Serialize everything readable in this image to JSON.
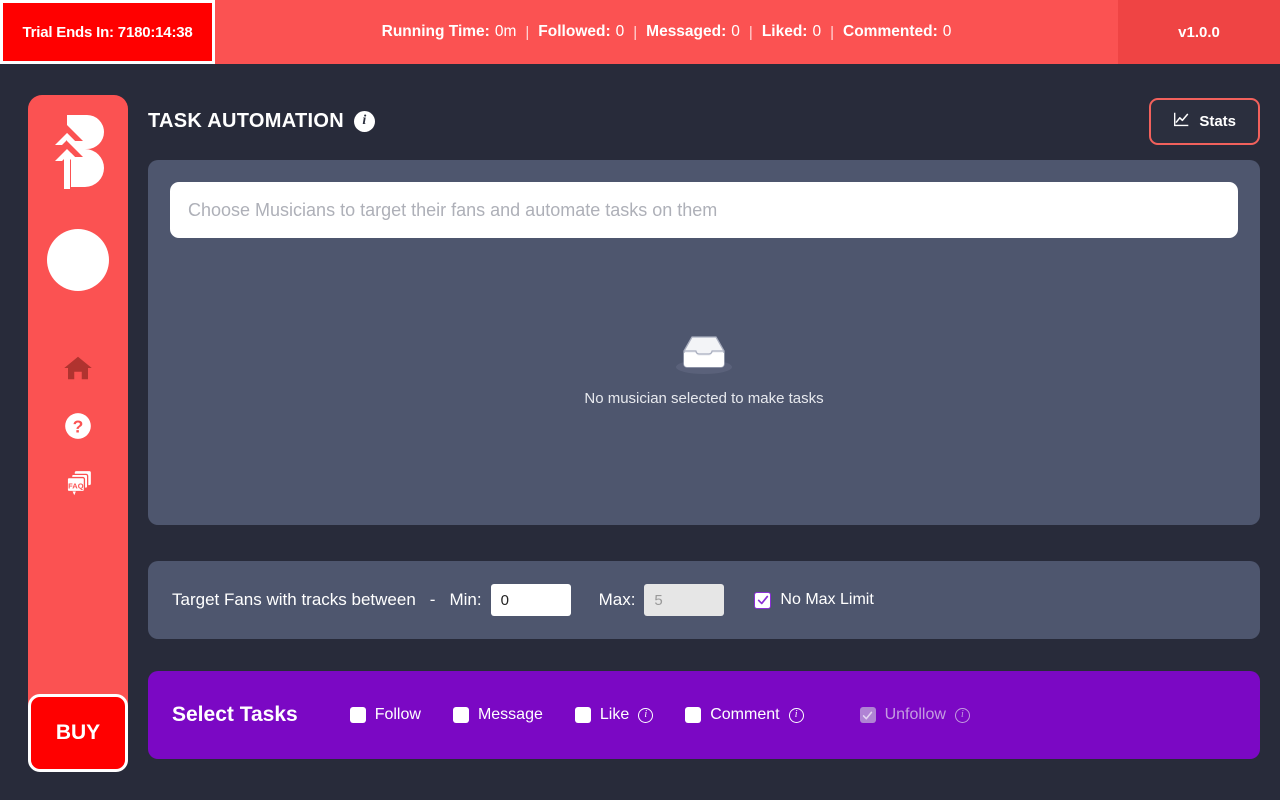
{
  "topbar": {
    "trial_label": "Trial Ends In: 7180:14:38",
    "stats": [
      {
        "label": "Running Time:",
        "value": "0m"
      },
      {
        "label": "Followed:",
        "value": "0"
      },
      {
        "label": "Messaged:",
        "value": "0"
      },
      {
        "label": "Liked:",
        "value": "0"
      },
      {
        "label": "Commented:",
        "value": "0"
      }
    ],
    "separator": "|",
    "version": "v1.0.0",
    "colors": {
      "bar": "#fb5252",
      "trial_bg": "#ff0000",
      "version_bg": "#ef4444"
    }
  },
  "sidebar": {
    "logo_name": "app-logo-b",
    "items": [
      {
        "icon": "home-icon",
        "name": "sidebar-item-home"
      },
      {
        "icon": "help-circle-icon",
        "name": "sidebar-item-help"
      },
      {
        "icon": "faq-cards-icon",
        "name": "sidebar-item-faq"
      }
    ],
    "buy_label": "BUY",
    "colors": {
      "bg": "#fb5252",
      "buy_bg": "#ff0000"
    }
  },
  "header": {
    "title": "TASK AUTOMATION",
    "info_icon": "info-filled-icon",
    "stats_button": {
      "label": "Stats",
      "icon": "chart-line-icon",
      "border_color": "#f2615c"
    }
  },
  "selector_panel": {
    "search": {
      "value": "",
      "placeholder": "Choose Musicians to target their fans and automate tasks on them"
    },
    "empty": {
      "icon": "empty-tray-icon",
      "text": "No musician selected to make tasks"
    }
  },
  "range_panel": {
    "label": "Target Fans with tracks between",
    "dash": "-",
    "min": {
      "label": "Min:",
      "value": "0",
      "placeholder": ""
    },
    "max": {
      "label": "Max:",
      "value": "",
      "placeholder": "5",
      "disabled": true
    },
    "no_max_limit": {
      "label": "No Max Limit",
      "checked": true,
      "accent": "#8b2fd6"
    }
  },
  "tasks_panel": {
    "title": "Select Tasks",
    "bg_color": "#7b08c4",
    "items": [
      {
        "label": "Follow",
        "checked": false,
        "disabled": false,
        "info": false
      },
      {
        "label": "Message",
        "checked": false,
        "disabled": false,
        "info": false
      },
      {
        "label": "Like",
        "checked": false,
        "disabled": false,
        "info": true
      },
      {
        "label": "Comment",
        "checked": false,
        "disabled": false,
        "info": true
      },
      {
        "label": "Unfollow",
        "checked": true,
        "disabled": true,
        "info": true
      }
    ]
  }
}
